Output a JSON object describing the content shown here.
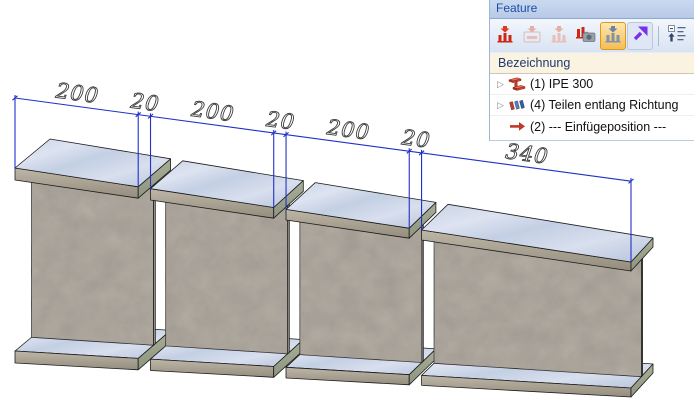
{
  "feature_panel": {
    "title": "Feature",
    "column_header": "Bezeichnung",
    "toolbar": [
      {
        "icon": "insert-feature-icon",
        "state": "enabled"
      },
      {
        "icon": "insert-feature-above-icon",
        "state": "disabled"
      },
      {
        "icon": "insert-feature-below-icon",
        "state": "disabled"
      },
      {
        "icon": "feature-snapshot-icon",
        "state": "enabled"
      },
      {
        "icon": "feature-list-icon",
        "state": "active"
      },
      {
        "icon": "goto-feature-icon",
        "state": "enabled"
      },
      {
        "icon": "separator",
        "state": "none"
      },
      {
        "icon": "collapse-tree-icon",
        "state": "enabled"
      },
      {
        "icon": "sort-features-icon",
        "state": "enabled"
      }
    ],
    "tree": [
      {
        "has_children": true,
        "icon": "ipe-beam-icon",
        "label": "(1) IPE 300"
      },
      {
        "has_children": true,
        "icon": "divide-along-direction-icon",
        "label": "(4) Teilen entlang Richtung"
      },
      {
        "has_children": false,
        "icon": "insert-position-arrow-icon",
        "label": "(2) --- Einfügeposition ---"
      }
    ]
  },
  "viewport": {
    "dimension_labels": [
      "200",
      "20",
      "200",
      "20",
      "200",
      "20",
      "340"
    ],
    "segments_mm": [
      200,
      200,
      200,
      340
    ],
    "gap_mm": 20,
    "dimension_color": "#2030c8"
  },
  "colors": {
    "panel_header_text": "#1d4ea6",
    "column_header_text": "#1e3a70",
    "active_button": "#f7bd55",
    "flange_steel": "#c6d0e2",
    "web_steel": "#aba49a"
  }
}
